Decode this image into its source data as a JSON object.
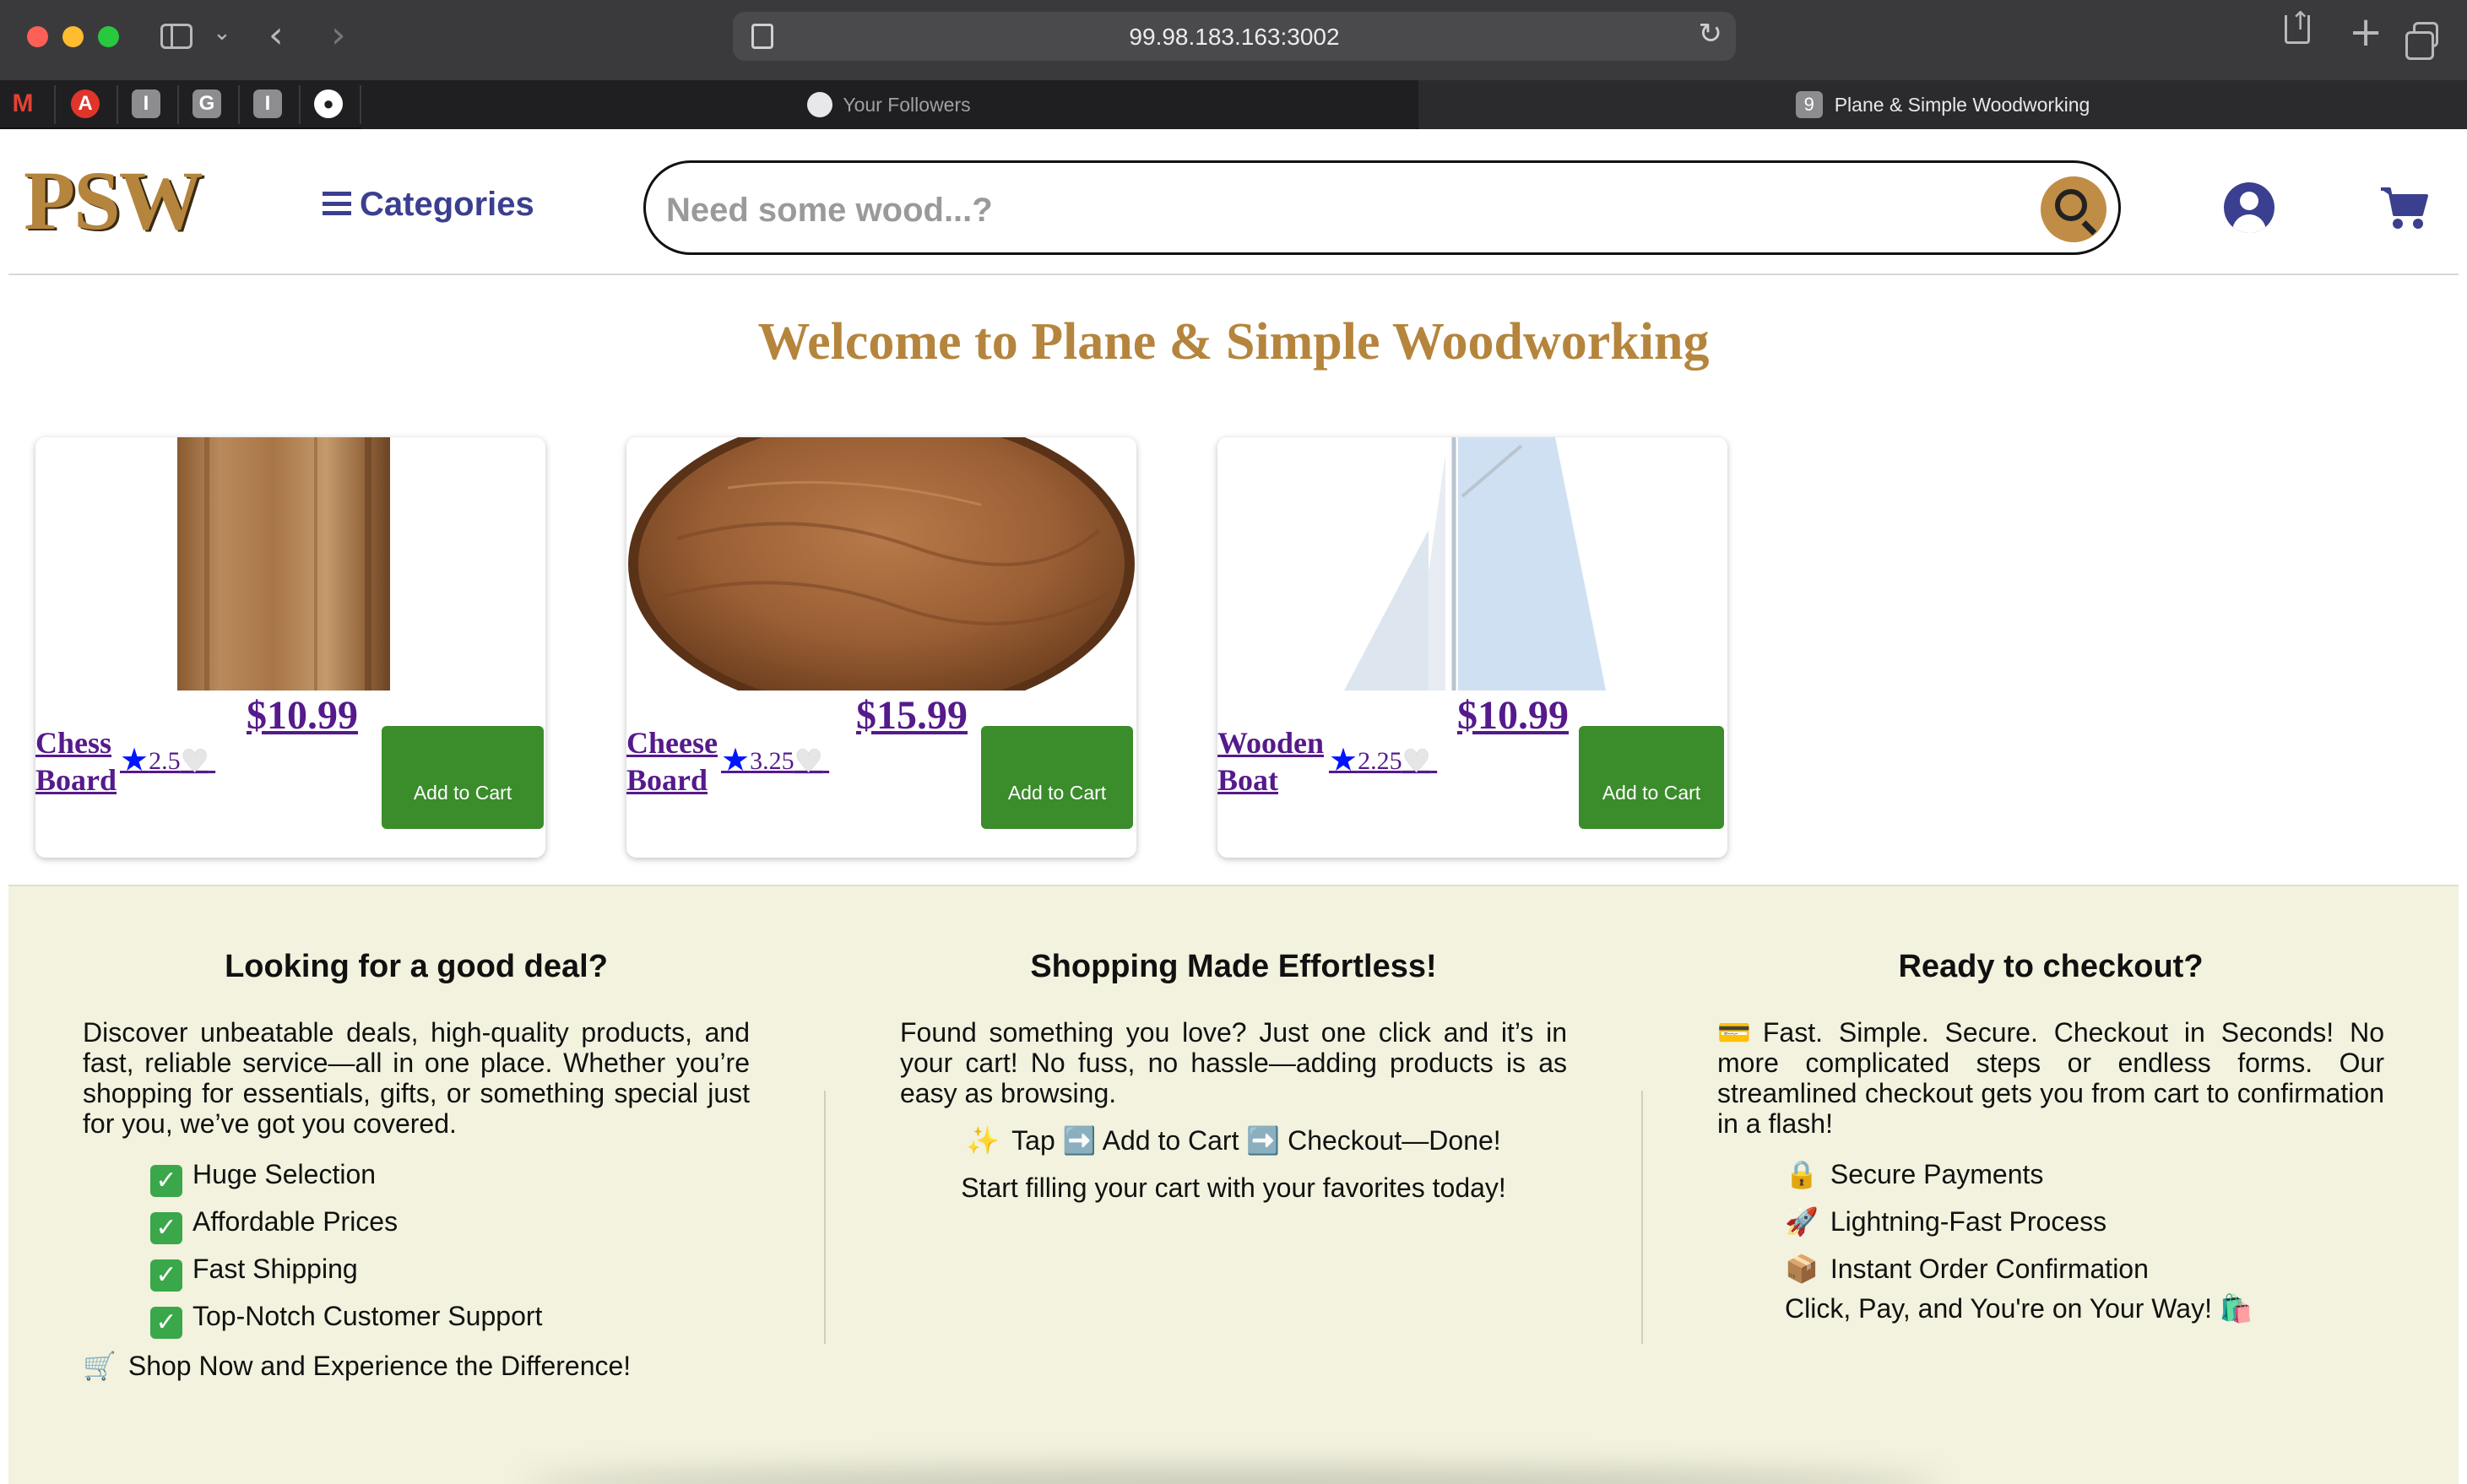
{
  "browser": {
    "url": "99.98.183.163:3002",
    "tabs": [
      {
        "label": "Your Followers",
        "active": false
      },
      {
        "label": "Plane & Simple Woodworking",
        "active": true,
        "favicon": "9"
      }
    ],
    "pinned": [
      "gmail-icon",
      "A",
      "I",
      "G",
      "I",
      "github-icon"
    ]
  },
  "header": {
    "logo": "PSW",
    "categories_label": "Categories",
    "search_placeholder": "Need some wood...?"
  },
  "page": {
    "welcome": "Welcome to Plane & Simple Woodworking"
  },
  "products": [
    {
      "name": "Chess Board",
      "price": "$10.99",
      "rating": "2.5",
      "button": "Add to Cart"
    },
    {
      "name": "Cheese Board",
      "price": "$15.99",
      "rating": "3.25",
      "button": "Add to Cart"
    },
    {
      "name": "Wooden Boat",
      "price": "$10.99",
      "rating": "2.25",
      "button": "Add to Cart"
    }
  ],
  "promo": {
    "deal": {
      "heading": "Looking for a good deal?",
      "body": "Discover unbeatable deals, high-quality products, and fast, reliable service—all in one place. Whether you’re shopping for essentials, gifts, or something special just for you, we’ve got you covered.",
      "items": [
        "Huge Selection",
        "Affordable Prices",
        "Fast Shipping",
        "Top-Notch Customer Support"
      ],
      "footer": "Shop Now and Experience the Difference!"
    },
    "shopping": {
      "heading": "Shopping Made Effortless!",
      "body": "Found something you love? Just one click and it’s in your cart! No fuss, no hassle—adding products is as easy as browsing.",
      "steps": "Tap ➡️ Add to Cart ➡️ Checkout—Done!",
      "footer": "Start filling your cart with your favorites today!"
    },
    "checkout": {
      "heading": "Ready to checkout?",
      "body": "Fast. Simple. Secure. Checkout in Seconds! No more complicated steps or endless forms. Our streamlined checkout gets you from cart to confirmation in a flash!",
      "items": [
        "Secure Payments",
        "Lightning-Fast Process",
        "Instant Order Confirmation"
      ],
      "footer": "Click, Pay, and You're on Your Way!"
    }
  },
  "colors": {
    "brand_gold": "#b5853d",
    "nav_blue": "#3b3f8f",
    "cart_green": "#3b8c2b",
    "promo_bg": "#f2f2de"
  }
}
